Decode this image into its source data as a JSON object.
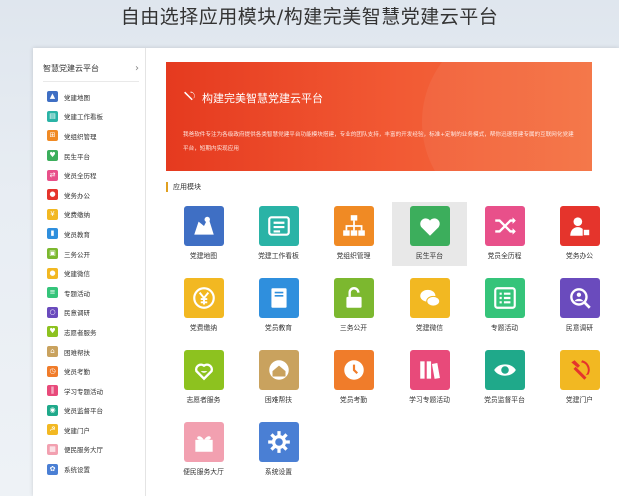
{
  "page_title": "自由选择应用模块/构建完美智慧党建云平台",
  "sidebar": {
    "header": "智慧党建云平台",
    "items": [
      {
        "label": "党建地图",
        "icon": "map-icon",
        "color": "#3f6fc4"
      },
      {
        "label": "党建工作看板",
        "icon": "dashboard-icon",
        "color": "#2ab3a6"
      },
      {
        "label": "党组织管理",
        "icon": "org-chart-icon",
        "color": "#f08a24"
      },
      {
        "label": "民生平台",
        "icon": "heart-icon",
        "color": "#3cae5c"
      },
      {
        "label": "党员全历程",
        "icon": "shuffle-icon",
        "color": "#e8508a"
      },
      {
        "label": "党务办公",
        "icon": "user-stamp-icon",
        "color": "#e5342c"
      },
      {
        "label": "党费缴纳",
        "icon": "coin-icon",
        "color": "#f2b822"
      },
      {
        "label": "党员教育",
        "icon": "book-icon",
        "color": "#2f8fdd"
      },
      {
        "label": "三务公开",
        "icon": "lock-icon",
        "color": "#7cb82f"
      },
      {
        "label": "党建微信",
        "icon": "wechat-icon",
        "color": "#f2b822"
      },
      {
        "label": "专题活动",
        "icon": "list-icon",
        "color": "#35c47a"
      },
      {
        "label": "民意调研",
        "icon": "search-user-icon",
        "color": "#6a4bbd"
      },
      {
        "label": "志愿者服务",
        "icon": "volunteer-icon",
        "color": "#8dc21f"
      },
      {
        "label": "困难帮扶",
        "icon": "house-icon",
        "color": "#c9a25e"
      },
      {
        "label": "党员考勤",
        "icon": "clock-icon",
        "color": "#f07c2a"
      },
      {
        "label": "学习专题活动",
        "icon": "books-icon",
        "color": "#e84a7a"
      },
      {
        "label": "党员监督平台",
        "icon": "eye-icon",
        "color": "#1fa98a"
      },
      {
        "label": "党建门户",
        "icon": "hammer-sickle-icon",
        "color": "#f2b822"
      },
      {
        "label": "便民服务大厅",
        "icon": "gift-icon",
        "color": "#f2a0b0"
      },
      {
        "label": "系统设置",
        "icon": "gear-icon",
        "color": "#4a7fd4"
      }
    ]
  },
  "banner": {
    "title": "构建完美智慧党建云平台",
    "description": "我爸软件专注为各级政府提供各类智慧党建平台功能模块搭建，专业的团队支持，丰富的开发经验，标准+定制的业务模式，帮你迅速搭建专属的互联网化党建平台，短期内实现应用"
  },
  "section": {
    "title": "应用模块"
  },
  "modules": [
    {
      "label": "党建地图",
      "icon": "map-icon",
      "color": "#3f6fc4"
    },
    {
      "label": "党建工作看板",
      "icon": "dashboard-icon",
      "color": "#2ab3a6"
    },
    {
      "label": "党组织管理",
      "icon": "org-chart-icon",
      "color": "#f08a24"
    },
    {
      "label": "民生平台",
      "icon": "heart-icon",
      "color": "#3cae5c"
    },
    {
      "label": "党员全历程",
      "icon": "shuffle-icon",
      "color": "#e8508a"
    },
    {
      "label": "党务办公",
      "icon": "user-stamp-icon",
      "color": "#e5342c"
    },
    {
      "label": "党费缴纳",
      "icon": "coin-icon",
      "color": "#f2b822"
    },
    {
      "label": "党员教育",
      "icon": "book-icon",
      "color": "#2f8fdd"
    },
    {
      "label": "三务公开",
      "icon": "lock-icon",
      "color": "#7cb82f"
    },
    {
      "label": "党建微信",
      "icon": "wechat-icon",
      "color": "#f2b822"
    },
    {
      "label": "专题活动",
      "icon": "list-icon",
      "color": "#35c47a"
    },
    {
      "label": "民意调研",
      "icon": "search-user-icon",
      "color": "#6a4bbd"
    },
    {
      "label": "志愿者服务",
      "icon": "volunteer-icon",
      "color": "#8dc21f"
    },
    {
      "label": "困难帮扶",
      "icon": "house-icon",
      "color": "#c9a25e"
    },
    {
      "label": "党员考勤",
      "icon": "clock-icon",
      "color": "#f07c2a"
    },
    {
      "label": "学习专题活动",
      "icon": "books-icon",
      "color": "#e84a7a"
    },
    {
      "label": "党员监督平台",
      "icon": "eye-icon",
      "color": "#1fa98a"
    },
    {
      "label": "党建门户",
      "icon": "hammer-sickle-icon",
      "color": "#f2b822"
    },
    {
      "label": "便民服务大厅",
      "icon": "gift-icon",
      "color": "#f2a0b0"
    },
    {
      "label": "系统设置",
      "icon": "gear-icon",
      "color": "#4a7fd4"
    }
  ],
  "selected_module": "民生平台"
}
